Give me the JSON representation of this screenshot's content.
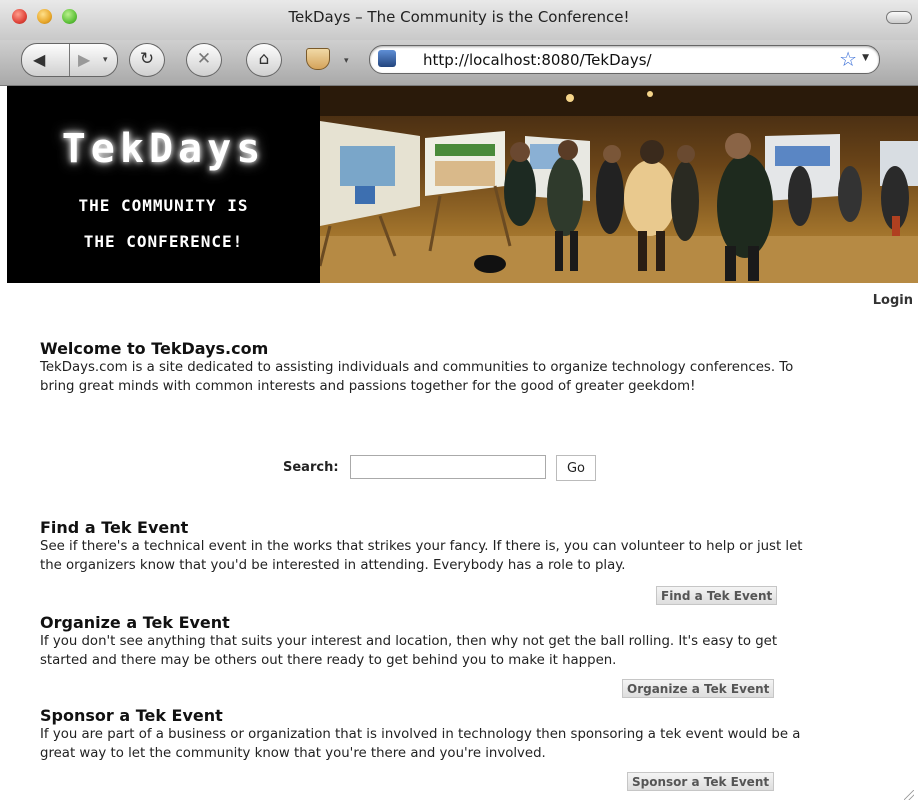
{
  "window": {
    "title": "TekDays – The Community is the Conference!",
    "url": "http://localhost:8080/TekDays/"
  },
  "toolbar": {
    "back_icon": "back-arrow-icon",
    "forward_icon": "forward-arrow-icon",
    "reload_icon": "reload-icon",
    "stop_icon": "stop-icon",
    "home_icon": "home-icon",
    "addon_icon": "coffee-cup-icon",
    "bookmark_icon": "star-icon"
  },
  "banner": {
    "logo": "TekDays",
    "tagline_line1": "THE COMMUNITY IS",
    "tagline_line2": "THE CONFERENCE!"
  },
  "header": {
    "login": "Login"
  },
  "welcome": {
    "heading": "Welcome to TekDays.com",
    "text": "TekDays.com is a site dedicated to assisting individuals and communities to organize technology conferences. To bring great minds with common interests and passions together for the good of greater geekdom!"
  },
  "search": {
    "label": "Search:",
    "value": "",
    "button": "Go"
  },
  "sections": [
    {
      "heading": "Find a Tek Event",
      "text": "See if there's a technical event in the works that strikes your fancy. If there is, you can volunteer to help or just let the organizers know that you'd be interested in attending. Everybody has a role to play.",
      "button": "Find a Tek Event"
    },
    {
      "heading": "Organize a Tek Event",
      "text": "If you don't see anything that suits your interest and location, then why not get the ball rolling. It's easy to get started and there may be others out there ready to get behind you to make it happen.",
      "button": "Organize a Tek Event"
    },
    {
      "heading": "Sponsor a Tek Event",
      "text": "If you are part of a business or organization that is involved in technology then sponsoring a tek event would be a great way to let the community know that you're there and you're involved.",
      "button": "Sponsor a Tek Event"
    }
  ]
}
